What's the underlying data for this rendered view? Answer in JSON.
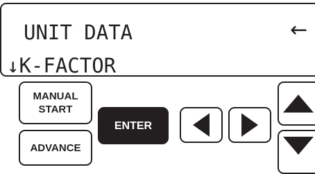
{
  "display": {
    "line1": "UNIT DATA",
    "line2": "↓K-FACTOR",
    "back_indicator": "←"
  },
  "buttons": {
    "manual_start": "MANUAL\nSTART",
    "advance": "ADVANCE",
    "enter": "ENTER"
  },
  "icons": {
    "left": "left-arrow-icon",
    "right": "right-arrow-icon",
    "up": "up-arrow-icon",
    "down": "down-arrow-icon"
  },
  "colors": {
    "ink": "#231f20",
    "background": "#ffffff"
  }
}
